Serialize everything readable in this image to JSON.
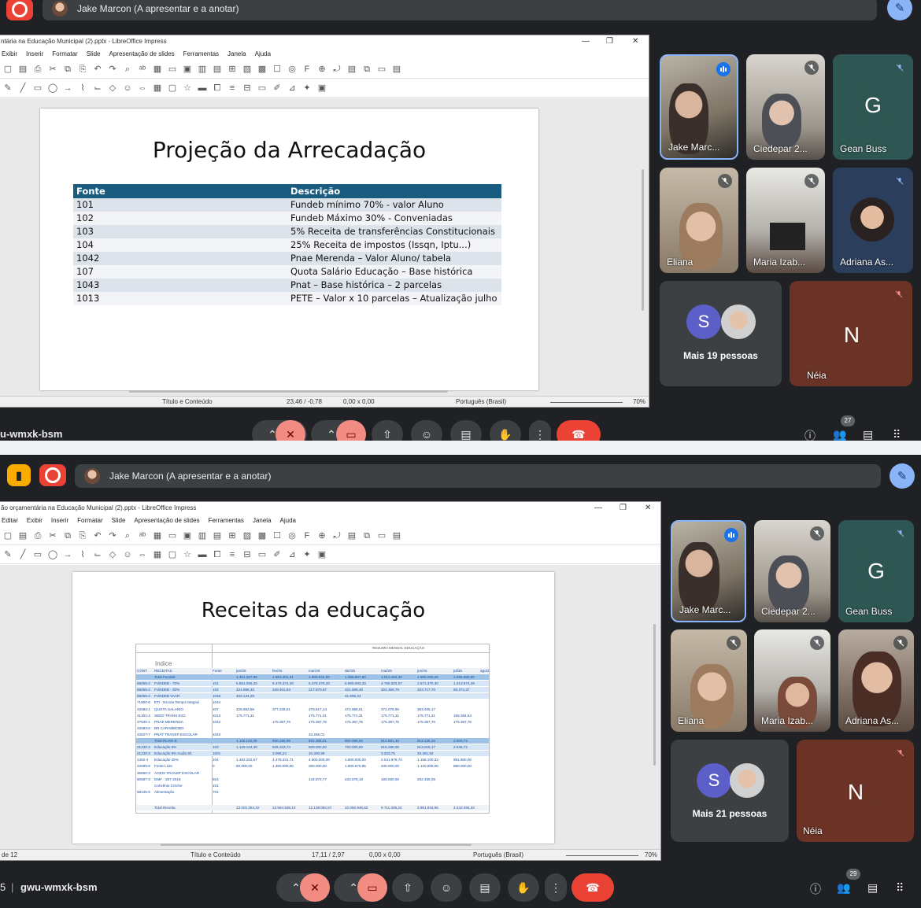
{
  "top": {
    "presenter": "Jake Marcon (A apresentar e a anotar)",
    "window_title": "ntária na Educação Municipal (2).pptx - LibreOffice Impress",
    "menu": [
      "Exibir",
      "Inserir",
      "Formatar",
      "Slide",
      "Apresentação de slides",
      "Ferramentas",
      "Janela",
      "Ajuda"
    ],
    "slide_title": "Projeção da Arrecadação",
    "table": {
      "headers": [
        "Fonte",
        "Descrição"
      ],
      "rows": [
        [
          "101",
          "Fundeb mínimo 70% - valor Aluno"
        ],
        [
          "102",
          "Fundeb Máximo 30% - Conveniadas"
        ],
        [
          "103",
          "5% Receita de transferências Constitucionais"
        ],
        [
          "104",
          "25% Receita de impostos (Issqn, Iptu...)"
        ],
        [
          "1042",
          "Pnae Merenda – Valor Aluno/ tabela"
        ],
        [
          "107",
          "Quota Salário Educação – Base histórica"
        ],
        [
          "1043",
          "Pnat – Base histórica – 2 parcelas"
        ],
        [
          "1013",
          "PETE – Valor  x 10 parcelas – Atualização julho"
        ]
      ]
    },
    "status": {
      "layout": "Título e Conteúdo",
      "position": "23,46 / -0,78",
      "size": "0,00 x 0,00",
      "language": "Português (Brasil)",
      "zoom": "70%"
    },
    "meeting_code": "u-wmxk-bsm",
    "participants_count": "27",
    "others": "Mais 19 pessoas",
    "tiles": [
      "Jake Marc...",
      "Ciedepar 2...",
      "Gean Buss",
      "Eliana",
      "Maria Izab...",
      "Adriana As...",
      "Néia"
    ],
    "letters": {
      "gean": "G",
      "others": "S",
      "neia": "N"
    }
  },
  "bottom": {
    "presenter": "Jake Marcon (A apresentar e a anotar)",
    "window_title": "ão orçamentária na Educação Municipal (2).pptx - LibreOffice Impress",
    "menu": [
      "Editar",
      "Exibir",
      "Inserir",
      "Formatar",
      "Slide",
      "Apresentação de slides",
      "Ferramentas",
      "Janela",
      "Ajuda"
    ],
    "slide_title": "Receitas da educação",
    "sheet": {
      "title": "RESUMO MENSAL EDUCAÇÃO",
      "index_label": "Indice",
      "headers": [
        "CONT",
        "RECEITAS",
        "Fonte",
        "jan/25",
        "fev/25",
        "mar/25",
        "abr/25",
        "mai/25",
        "jun/25",
        "jul/25",
        "ago/25"
      ],
      "rows": [
        [
          "",
          "Total Fundeb",
          "",
          "1.401.367,96",
          "1.651.401,31",
          "1.900.842,80",
          "1.385.867,80",
          "1.012.463,20",
          "1.980.280,26",
          "1.596.680,80",
          ""
        ],
        [
          "65055-2",
          "FUNDEB - 70%",
          "101",
          "6.851.055,33",
          "6.475.374,48",
          "6.375.370,33",
          "5.965.083,33",
          "4.768.303,07",
          "1.571.370,40",
          "1.413.874,49",
          ""
        ],
        [
          "65055-2",
          "FUNDEB - 30%",
          "102",
          "424.988,33",
          "349.401,83",
          "217.570,67",
          "321.669,49",
          "304.359,79",
          "323.717,70",
          "93.374,37",
          ""
        ],
        [
          "65055-2",
          "FUNDEB VAAR",
          "1046",
          "403.144,29",
          "",
          "",
          "31.596,34",
          "",
          "",
          "",
          ""
        ],
        [
          "71900-6",
          "ETI - Escola Tempo Integral",
          "1044",
          "",
          "",
          "",
          "",
          "",
          "",
          "",
          ""
        ],
        [
          "32084-1",
          "QUOTA SALARIO",
          "107",
          "426.652,58",
          "377.235,51",
          "378.517,14",
          "372.959,51",
          "372.078,95",
          "383.405,17",
          ""
        ],
        [
          "31301-4",
          "SEED TRANS EXC.",
          "1013",
          "175.771,31",
          "",
          "175.771,31",
          "175.771,31",
          "175.771,31",
          "175.771,31",
          "156.384,54",
          ""
        ],
        [
          "37530-1",
          "PNAE MERENDA",
          "1042",
          "",
          "175.367,75",
          "175.367,75",
          "175.367,75",
          "175.367,75",
          "175.367,75",
          "175.367,75",
          ""
        ],
        [
          "32083-6",
          "BR CARAMBOBO",
          "",
          "",
          "",
          "",
          "",
          "",
          "",
          "",
          ""
        ],
        [
          "32827-7",
          "PNAT TRANSP ESCOLAR",
          "1043",
          "",
          "",
          "33.256,01",
          "",
          "",
          "",
          "",
          ""
        ],
        [
          "",
          "Total RLIXE-E",
          "",
          "1.116.123,29",
          "930.155,99",
          "931.306,41",
          "900.066,00",
          "914.581,32",
          "913.145,26",
          "2.000,72",
          ""
        ],
        [
          "21230-3",
          "Educação 5%",
          "103",
          "1.129.124,30",
          "925.103,74",
          "920.000,00",
          "700.000,00",
          "915.280,00",
          "913.015,17",
          "2.046,72",
          ""
        ],
        [
          "21230-3",
          "Educação 8% Audio 6h",
          "1001",
          "",
          "3.096,24",
          "10.300,99",
          "",
          "3.203,75",
          "33.361,62",
          "",
          ""
        ],
        [
          "1402-4",
          "Educação 25%",
          "104",
          "1.482.202,57",
          "4.478.331,71",
          "4.900.000,00",
          "1.800.000,00",
          "2.041.978,74",
          "1.158.100,34",
          "981.900,06",
          ""
        ],
        [
          "34099-8",
          "Fonte Livre",
          "0",
          "80.000,00",
          "1.360.000,00",
          "260.000,00",
          "1.800.570,95",
          "340.000,00",
          "1.120.006,00",
          "880.000,00",
          ""
        ],
        [
          "36650-3",
          "AGEIS TRANSP ESCOLAR",
          "",
          "",
          "",
          "",
          "",
          "",
          "",
          "",
          ""
        ],
        [
          "80587-3",
          "DMF - 357-2018",
          "924",
          "",
          "",
          "144.873,77",
          "233.579,18",
          "169.000,00",
          "262.458,09",
          "",
          ""
        ],
        [
          "",
          "Convênio Creche",
          "151",
          "",
          "",
          "",
          "",
          "",
          "",
          "",
          ""
        ],
        [
          "68135-6",
          "Alimentação",
          "701",
          "",
          "",
          "",
          "",
          "",
          "",
          "",
          ""
        ]
      ],
      "total": [
        "",
        "Total Receita",
        "",
        "13.002.254,32",
        "13.564.539,10",
        "12.138.082,67",
        "10.050.946,82",
        "9.711.309,22",
        "3.981.934,65",
        "3.442.455,33",
        ""
      ]
    },
    "status": {
      "slide": "de 12",
      "layout": "Título e Conteúdo",
      "position": "17,11 / 2,97",
      "size": "0,00 x 0,00",
      "language": "Português (Brasil)",
      "zoom": "70%"
    },
    "meeting_prefix": "5",
    "meeting_code": "gwu-wmxk-bsm",
    "participants_count": "29",
    "others": "Mais 21 pessoas",
    "tiles": [
      "Jake Marc...",
      "Ciedepar 2...",
      "Gean Buss",
      "Eliana",
      "Maria Izab...",
      "Adriana As...",
      "Néia"
    ],
    "letters": {
      "gean": "G",
      "others": "S",
      "neia": "N"
    }
  },
  "colors": {
    "meet_bg": "#202124",
    "table_header": "#1a5b80",
    "hangup": "#ea4335",
    "mic_off": "#f28b82",
    "accent": "#8ab4f8"
  }
}
